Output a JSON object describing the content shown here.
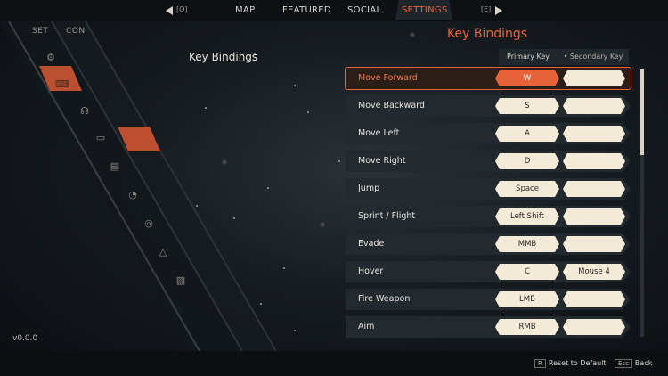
{
  "nav": {
    "prev_key": "[Q]",
    "next_key": "[E]",
    "tabs": [
      "MAP",
      "FEATURED",
      "SOCIAL",
      "SETTINGS"
    ],
    "active_tab": "SETTINGS"
  },
  "side_tabs": [
    "SET",
    "CON"
  ],
  "version": "v0.0.0",
  "panel_title": "Key Bindings",
  "section_title": "Key Bindings",
  "columns": {
    "primary": "Primary Key",
    "secondary": "• Secondary Key"
  },
  "bindings": [
    {
      "action": "Move Forward",
      "primary": "W",
      "secondary": "",
      "selected": true
    },
    {
      "action": "Move Backward",
      "primary": "S",
      "secondary": ""
    },
    {
      "action": "Move Left",
      "primary": "A",
      "secondary": ""
    },
    {
      "action": "Move Right",
      "primary": "D",
      "secondary": ""
    },
    {
      "action": "Jump",
      "primary": "Space",
      "secondary": ""
    },
    {
      "action": "Sprint / Flight",
      "primary": "Left Shift",
      "secondary": ""
    },
    {
      "action": "Evade",
      "primary": "MMB",
      "secondary": ""
    },
    {
      "action": "Hover",
      "primary": "C",
      "secondary": "Mouse 4"
    },
    {
      "action": "Fire Weapon",
      "primary": "LMB",
      "secondary": ""
    },
    {
      "action": "Aim",
      "primary": "RMB",
      "secondary": ""
    }
  ],
  "footer": {
    "reset_key": "R",
    "reset_label": "Reset to Default",
    "back_key": "Esc",
    "back_label": "Back"
  },
  "colors": {
    "accent": "#e8623a",
    "key_bg": "#f4ead8",
    "row_bg": "#222a30"
  }
}
